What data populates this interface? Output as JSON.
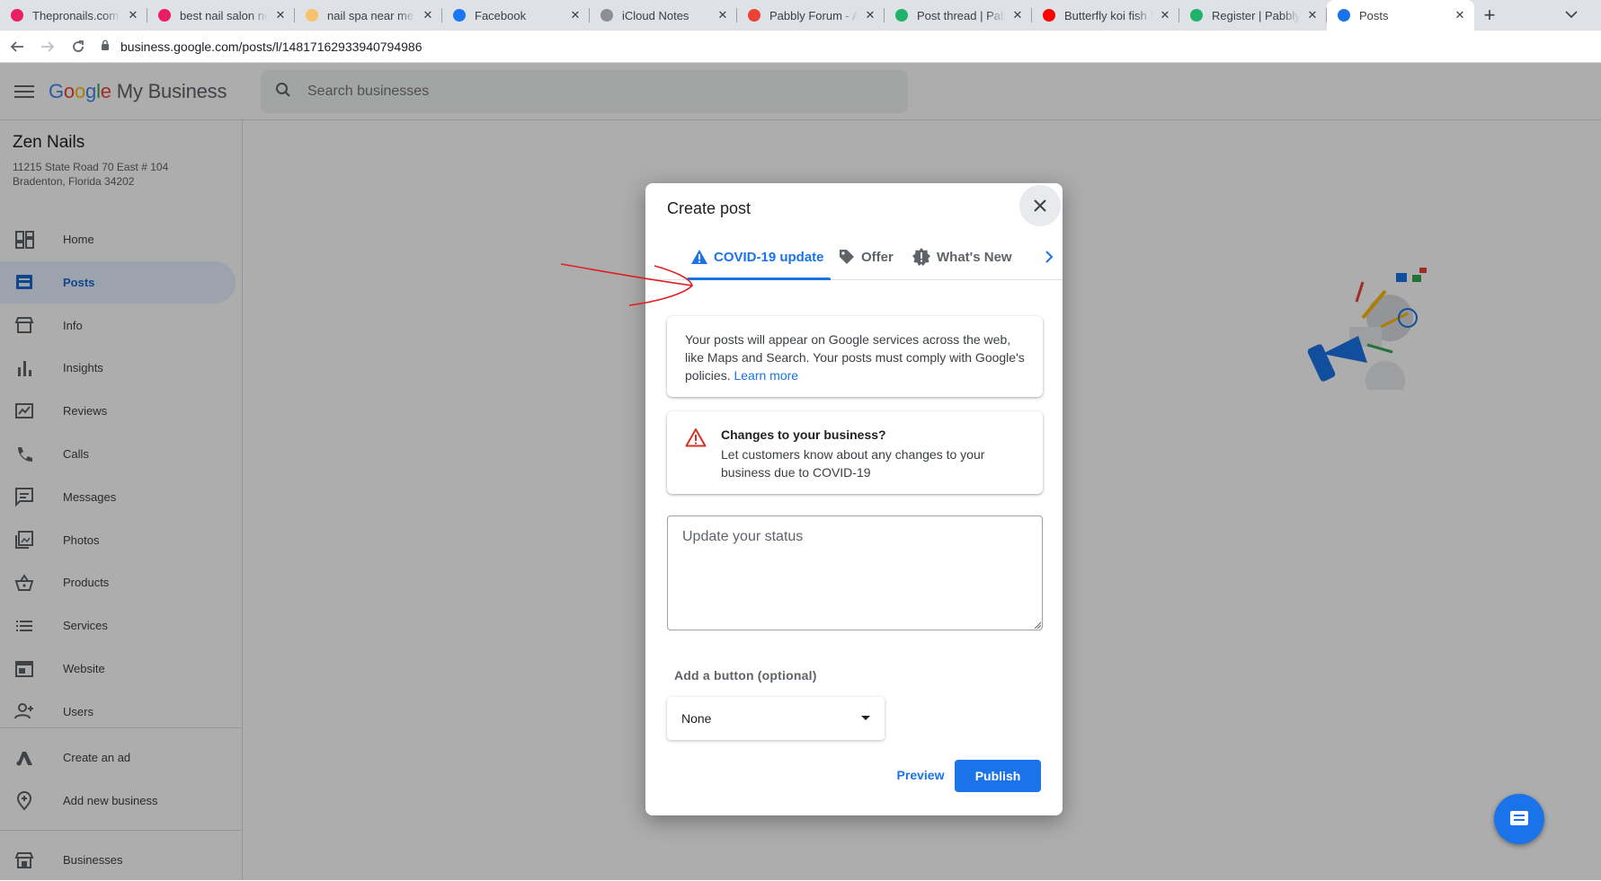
{
  "browser": {
    "tabs": [
      {
        "title": "Thepronails.com | S",
        "favicon_color": "#e91e63"
      },
      {
        "title": "best nail salon new",
        "favicon_color": "#e91e63"
      },
      {
        "title": "nail spa near me |",
        "favicon_color": "#f6c26b"
      },
      {
        "title": "Facebook",
        "favicon_color": "#1877f2"
      },
      {
        "title": "iCloud Notes",
        "favicon_color": "#8e8e93"
      },
      {
        "title": "Pabbly Forum - Ac",
        "favicon_color": "#ea4335"
      },
      {
        "title": "Post thread | Pabbl",
        "favicon_color": "#20b26b"
      },
      {
        "title": "Butterfly koi fish Bo",
        "favicon_color": "#ff0000"
      },
      {
        "title": "Register | Pabbly Fo",
        "favicon_color": "#20b26b"
      },
      {
        "title": "Posts",
        "favicon_color": "#1a73e8",
        "active": true
      }
    ],
    "new_tab_label": "+",
    "close_glyph": "✕",
    "url": "business.google.com/posts/l/14817162933940794986"
  },
  "app": {
    "logo_google": [
      "G",
      "o",
      "o",
      "g",
      "l",
      "e"
    ],
    "logo_suffix": "My Business",
    "search_placeholder": "Search businesses",
    "business": {
      "name": "Zen Nails",
      "address_line1": "11215 State Road 70 East # 104",
      "address_line2": "Bradenton, Florida 34202"
    },
    "nav": [
      {
        "label": "Home",
        "icon": "dashboard-icon"
      },
      {
        "label": "Posts",
        "icon": "posts-icon",
        "active": true
      },
      {
        "label": "Info",
        "icon": "storefront-icon"
      },
      {
        "label": "Insights",
        "icon": "bar-chart-icon"
      },
      {
        "label": "Reviews",
        "icon": "reviews-icon"
      },
      {
        "label": "Calls",
        "icon": "phone-icon"
      },
      {
        "label": "Messages",
        "icon": "message-icon"
      },
      {
        "label": "Photos",
        "icon": "photos-icon"
      },
      {
        "label": "Products",
        "icon": "basket-icon"
      },
      {
        "label": "Services",
        "icon": "list-icon"
      },
      {
        "label": "Website",
        "icon": "website-icon"
      },
      {
        "label": "Users",
        "icon": "add-user-icon"
      }
    ],
    "nav_secondary": [
      {
        "label": "Create an ad",
        "icon": "ads-icon"
      },
      {
        "label": "Add new business",
        "icon": "add-location-icon"
      }
    ],
    "nav_tertiary": [
      {
        "label": "Businesses",
        "icon": "store-icon"
      }
    ]
  },
  "dialog": {
    "title": "Create post",
    "tabs": [
      {
        "label": "COVID-19 update",
        "icon": "warning-icon",
        "active": true
      },
      {
        "label": "Offer",
        "icon": "tag-icon"
      },
      {
        "label": "What's New",
        "icon": "new-icon"
      }
    ],
    "info_text": "Your posts will appear on Google services across the web, like Maps and Search. Your posts must comply with Google's policies.",
    "learn_more": "Learn more",
    "covid_heading": "Changes to your business?",
    "covid_body": "Let customers know about any changes to your business due to COVID-19",
    "status_placeholder": "Update your status",
    "add_button_label": "Add a button (optional)",
    "button_select_value": "None",
    "preview_label": "Preview",
    "publish_label": "Publish"
  },
  "colors": {
    "accent": "#1a73e8",
    "warning_red": "#d93025",
    "annotation_red": "#e02020"
  }
}
